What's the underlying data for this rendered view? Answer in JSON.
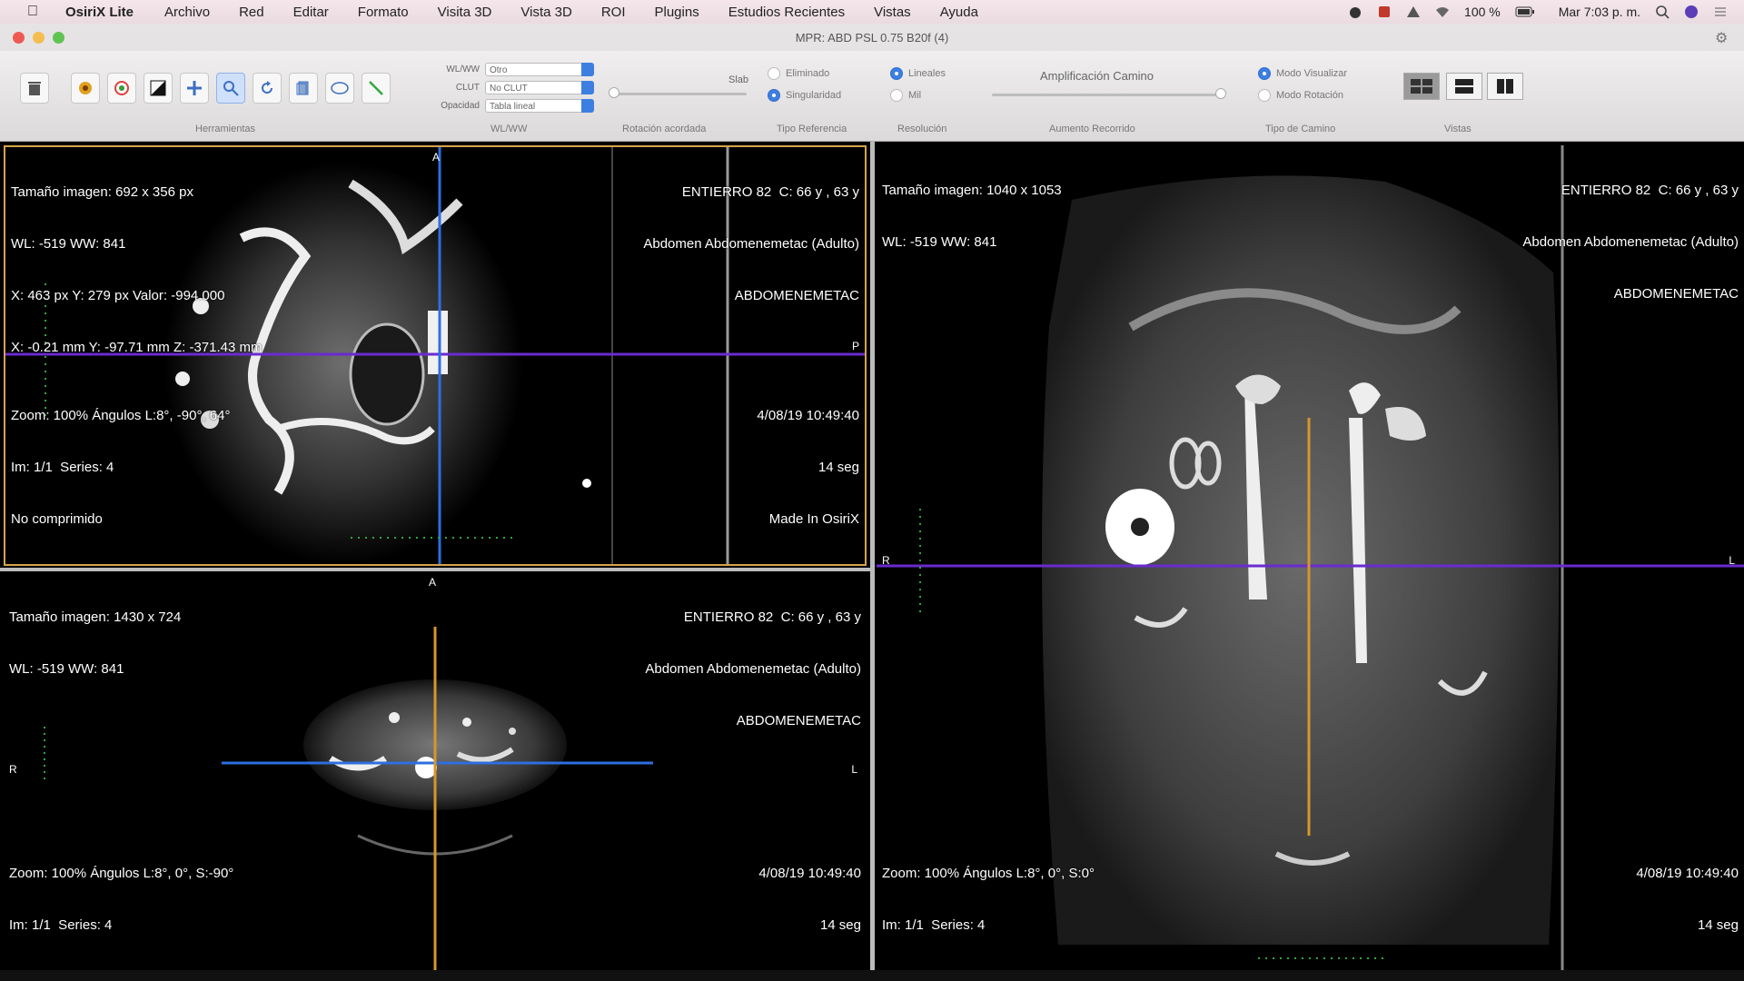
{
  "menubar": {
    "app_name": "OsiriX Lite",
    "items": [
      "Archivo",
      "Red",
      "Editar",
      "Formato",
      "Visita 3D",
      "Vista 3D",
      "ROI",
      "Plugins",
      "Estudios Recientes",
      "Vistas",
      "Ayuda"
    ],
    "battery": "100 %",
    "clock": "Mar 7:03 p. m."
  },
  "window": {
    "title": "MPR: ABD PSL 0.75 B20f (4)"
  },
  "toolbar": {
    "wlww_labels": [
      "WL/WW",
      "CLUT",
      "Opacidad"
    ],
    "wlww_values": [
      "Otro",
      "No CLUT",
      "Tabla lineal"
    ],
    "slab_label": "Slab",
    "radio_tipo": [
      "Eliminado",
      "Singularidad"
    ],
    "radio_resolucion": [
      "Lineales",
      "Mil"
    ],
    "magnification_label": "Amplificación Camino",
    "radio_camino": [
      "Modo Visualizar",
      "Modo Rotación"
    ],
    "group_labels": [
      "Herramientas",
      "WL/WW",
      "Rotación acordada",
      "Tipo Referencia",
      "Resolución",
      "Aumento Recorrido",
      "Tipo de Camino",
      "Vistas"
    ]
  },
  "viewports": {
    "top": {
      "tl": [
        "Tamaño imagen: 692 x 356 px",
        "WL: -519 WW: 841",
        "X: 463 px Y: 279 px Valor: -994.000",
        "X: -0.21 mm Y: -97.71 mm Z: -371.43 mm"
      ],
      "tr": [
        "ENTIERRO 82  C: 66 y , 63 y",
        "Abdomen Abdomenemetac (Adulto)",
        "ABDOMENEMETAC"
      ],
      "bl": [
        "Zoom: 100% Ángulos L:8°, -90°, 64°",
        "Im: 1/1  Series: 4",
        "No comprimido"
      ],
      "br": [
        "4/08/19 10:49:40",
        "14 seg",
        "Made In OsiriX"
      ],
      "orient": [
        "A",
        "P"
      ]
    },
    "bottom": {
      "tl": [
        "Tamaño imagen: 1430 x 724",
        "WL: -519 WW: 841"
      ],
      "tr": [
        "ENTIERRO 82  C: 66 y , 63 y",
        "Abdomen Abdomenemetac (Adulto)",
        "ABDOMENEMETAC"
      ],
      "bl": [
        "Zoom: 100% Ángulos L:8°, 0°, S:-90°",
        "Im: 1/1  Series: 4"
      ],
      "br": [
        "4/08/19 10:49:40",
        "14 seg"
      ],
      "orient": [
        "A",
        "R",
        "L"
      ]
    },
    "right": {
      "tl": [
        "Tamaño imagen: 1040 x 1053",
        "WL: -519 WW: 841"
      ],
      "tr": [
        "ENTIERRO 82  C: 66 y , 63 y",
        "Abdomen Abdomenemetac (Adulto)",
        "ABDOMENEMETAC"
      ],
      "bl": [
        "Zoom: 100% Ángulos L:8°, 0°, S:0°",
        "Im: 1/1  Series: 4"
      ],
      "br": [
        "4/08/19 10:49:40",
        "14 seg"
      ],
      "orient": [
        "R",
        "L"
      ]
    }
  },
  "colors": {
    "active_border": "#d6a34a",
    "crosshair_purple": "#6a2bd0",
    "crosshair_blue": "#2d6fe0",
    "crosshair_orange": "#d8962a",
    "scale_green": "#2ea83a"
  }
}
